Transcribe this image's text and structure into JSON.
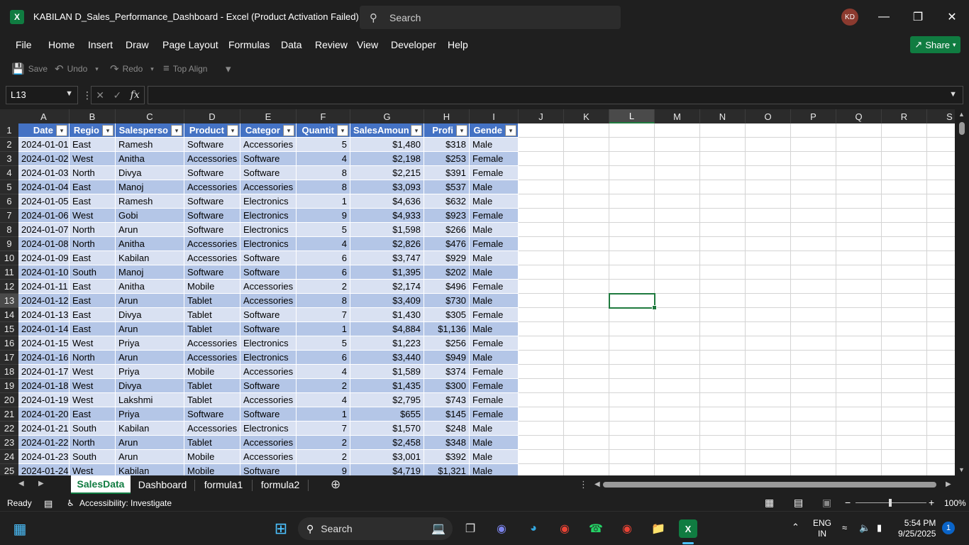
{
  "window": {
    "title": "KABILAN D_Sales_Performance_Dashboard  -  Excel (Product Activation Failed)",
    "search_placeholder": "Search",
    "avatar_initials": "KD",
    "app_icon": "X"
  },
  "menu": [
    "File",
    "Home",
    "Insert",
    "Draw",
    "Page Layout",
    "Formulas",
    "Data",
    "Review",
    "View",
    "Developer",
    "Help"
  ],
  "share_label": "Share",
  "quick_access": {
    "save": "Save",
    "undo": "Undo",
    "redo": "Redo",
    "top_align": "Top Align"
  },
  "formula_bar": {
    "name_box": "L13",
    "fx": "fx",
    "value": ""
  },
  "columns": [
    "A",
    "B",
    "C",
    "D",
    "E",
    "F",
    "G",
    "H",
    "I",
    "J",
    "K",
    "L",
    "M",
    "N",
    "O",
    "P",
    "Q",
    "R",
    "S"
  ],
  "selected_column": "L",
  "selected_row": 13,
  "table_headers": [
    "Date",
    "Regio",
    "Salesperso",
    "Product",
    "Categor",
    "Quantit",
    "SalesAmoun",
    "Profi",
    "Gende"
  ],
  "rows": [
    [
      "2024-01-01",
      "East",
      "Ramesh",
      "Software",
      "Accessories",
      "5",
      "$1,480",
      "$318",
      "Male"
    ],
    [
      "2024-01-02",
      "West",
      "Anitha",
      "Accessories",
      "Software",
      "4",
      "$2,198",
      "$253",
      "Female"
    ],
    [
      "2024-01-03",
      "North",
      "Divya",
      "Software",
      "Software",
      "8",
      "$2,215",
      "$391",
      "Female"
    ],
    [
      "2024-01-04",
      "East",
      "Manoj",
      "Accessories",
      "Accessories",
      "8",
      "$3,093",
      "$537",
      "Male"
    ],
    [
      "2024-01-05",
      "East",
      "Ramesh",
      "Software",
      "Electronics",
      "1",
      "$4,636",
      "$632",
      "Male"
    ],
    [
      "2024-01-06",
      "West",
      "Gobi",
      "Software",
      "Electronics",
      "9",
      "$4,933",
      "$923",
      "Female"
    ],
    [
      "2024-01-07",
      "North",
      "Arun",
      "Software",
      "Electronics",
      "5",
      "$1,598",
      "$266",
      "Male"
    ],
    [
      "2024-01-08",
      "North",
      "Anitha",
      "Accessories",
      "Electronics",
      "4",
      "$2,826",
      "$476",
      "Female"
    ],
    [
      "2024-01-09",
      "East",
      "Kabilan",
      "Accessories",
      "Software",
      "6",
      "$3,747",
      "$929",
      "Male"
    ],
    [
      "2024-01-10",
      "South",
      "Manoj",
      "Software",
      "Software",
      "6",
      "$1,395",
      "$202",
      "Male"
    ],
    [
      "2024-01-11",
      "East",
      "Anitha",
      "Mobile",
      "Accessories",
      "2",
      "$2,174",
      "$496",
      "Female"
    ],
    [
      "2024-01-12",
      "East",
      "Arun",
      "Tablet",
      "Accessories",
      "8",
      "$3,409",
      "$730",
      "Male"
    ],
    [
      "2024-01-13",
      "East",
      "Divya",
      "Tablet",
      "Software",
      "7",
      "$1,430",
      "$305",
      "Female"
    ],
    [
      "2024-01-14",
      "East",
      "Arun",
      "Tablet",
      "Software",
      "1",
      "$4,884",
      "$1,136",
      "Male"
    ],
    [
      "2024-01-15",
      "West",
      "Priya",
      "Accessories",
      "Electronics",
      "5",
      "$1,223",
      "$256",
      "Female"
    ],
    [
      "2024-01-16",
      "North",
      "Arun",
      "Accessories",
      "Electronics",
      "6",
      "$3,440",
      "$949",
      "Male"
    ],
    [
      "2024-01-17",
      "West",
      "Priya",
      "Mobile",
      "Accessories",
      "4",
      "$1,589",
      "$374",
      "Female"
    ],
    [
      "2024-01-18",
      "West",
      "Divya",
      "Tablet",
      "Software",
      "2",
      "$1,435",
      "$300",
      "Female"
    ],
    [
      "2024-01-19",
      "West",
      "Lakshmi",
      "Tablet",
      "Accessories",
      "4",
      "$2,795",
      "$743",
      "Female"
    ],
    [
      "2024-01-20",
      "East",
      "Priya",
      "Software",
      "Software",
      "1",
      "$655",
      "$145",
      "Female"
    ],
    [
      "2024-01-21",
      "South",
      "Kabilan",
      "Accessories",
      "Electronics",
      "7",
      "$1,570",
      "$248",
      "Male"
    ],
    [
      "2024-01-22",
      "North",
      "Arun",
      "Tablet",
      "Accessories",
      "2",
      "$2,458",
      "$348",
      "Male"
    ],
    [
      "2024-01-23",
      "South",
      "Arun",
      "Mobile",
      "Accessories",
      "2",
      "$3,001",
      "$392",
      "Male"
    ],
    [
      "2024-01-24",
      "West",
      "Kabilan",
      "Mobile",
      "Software",
      "9",
      "$4,719",
      "$1,321",
      "Male"
    ]
  ],
  "sheet_tabs": [
    "SalesData",
    "Dashboard",
    "formula1",
    "formula2"
  ],
  "active_tab": "SalesData",
  "status": {
    "ready": "Ready",
    "accessibility": "Accessibility: Investigate",
    "zoom": "100%"
  },
  "taskbar": {
    "search_placeholder": "Search",
    "lang_line1": "ENG",
    "lang_line2": "IN",
    "time": "5:54 PM",
    "date": "9/25/2025",
    "notification_count": "1"
  },
  "colors": {
    "excel_green": "#107c41",
    "table_header": "#4472c4",
    "band_dark": "#b4c6e7",
    "band_light": "#d9e1f2"
  }
}
